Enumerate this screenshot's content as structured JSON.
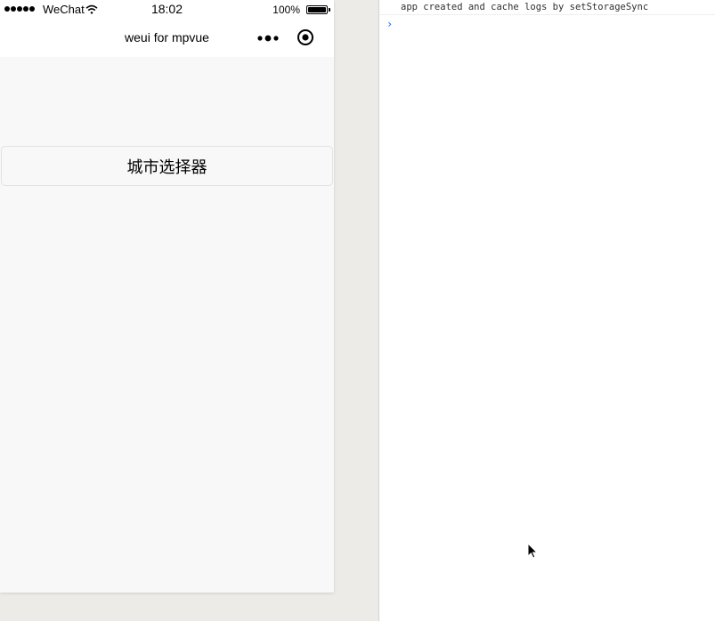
{
  "status_bar": {
    "carrier": "WeChat",
    "time": "18:02",
    "battery_percent": "100%",
    "icons": [
      "signal-dots-icon",
      "wifi-icon",
      "battery-icon"
    ]
  },
  "nav_bar": {
    "title": "weui for mpvue",
    "icons": [
      "more-dots-icon",
      "close-capsule-icon"
    ]
  },
  "page": {
    "picker_button_label": "城市选择器"
  },
  "console": {
    "log_message": "app created and cache logs by setStorageSync",
    "prompt_symbol": "›",
    "input_value": ""
  },
  "colors": {
    "page_background": "#f8f8f8",
    "console_prompt": "#367cf1",
    "desktop_background": "#ecebe7"
  }
}
